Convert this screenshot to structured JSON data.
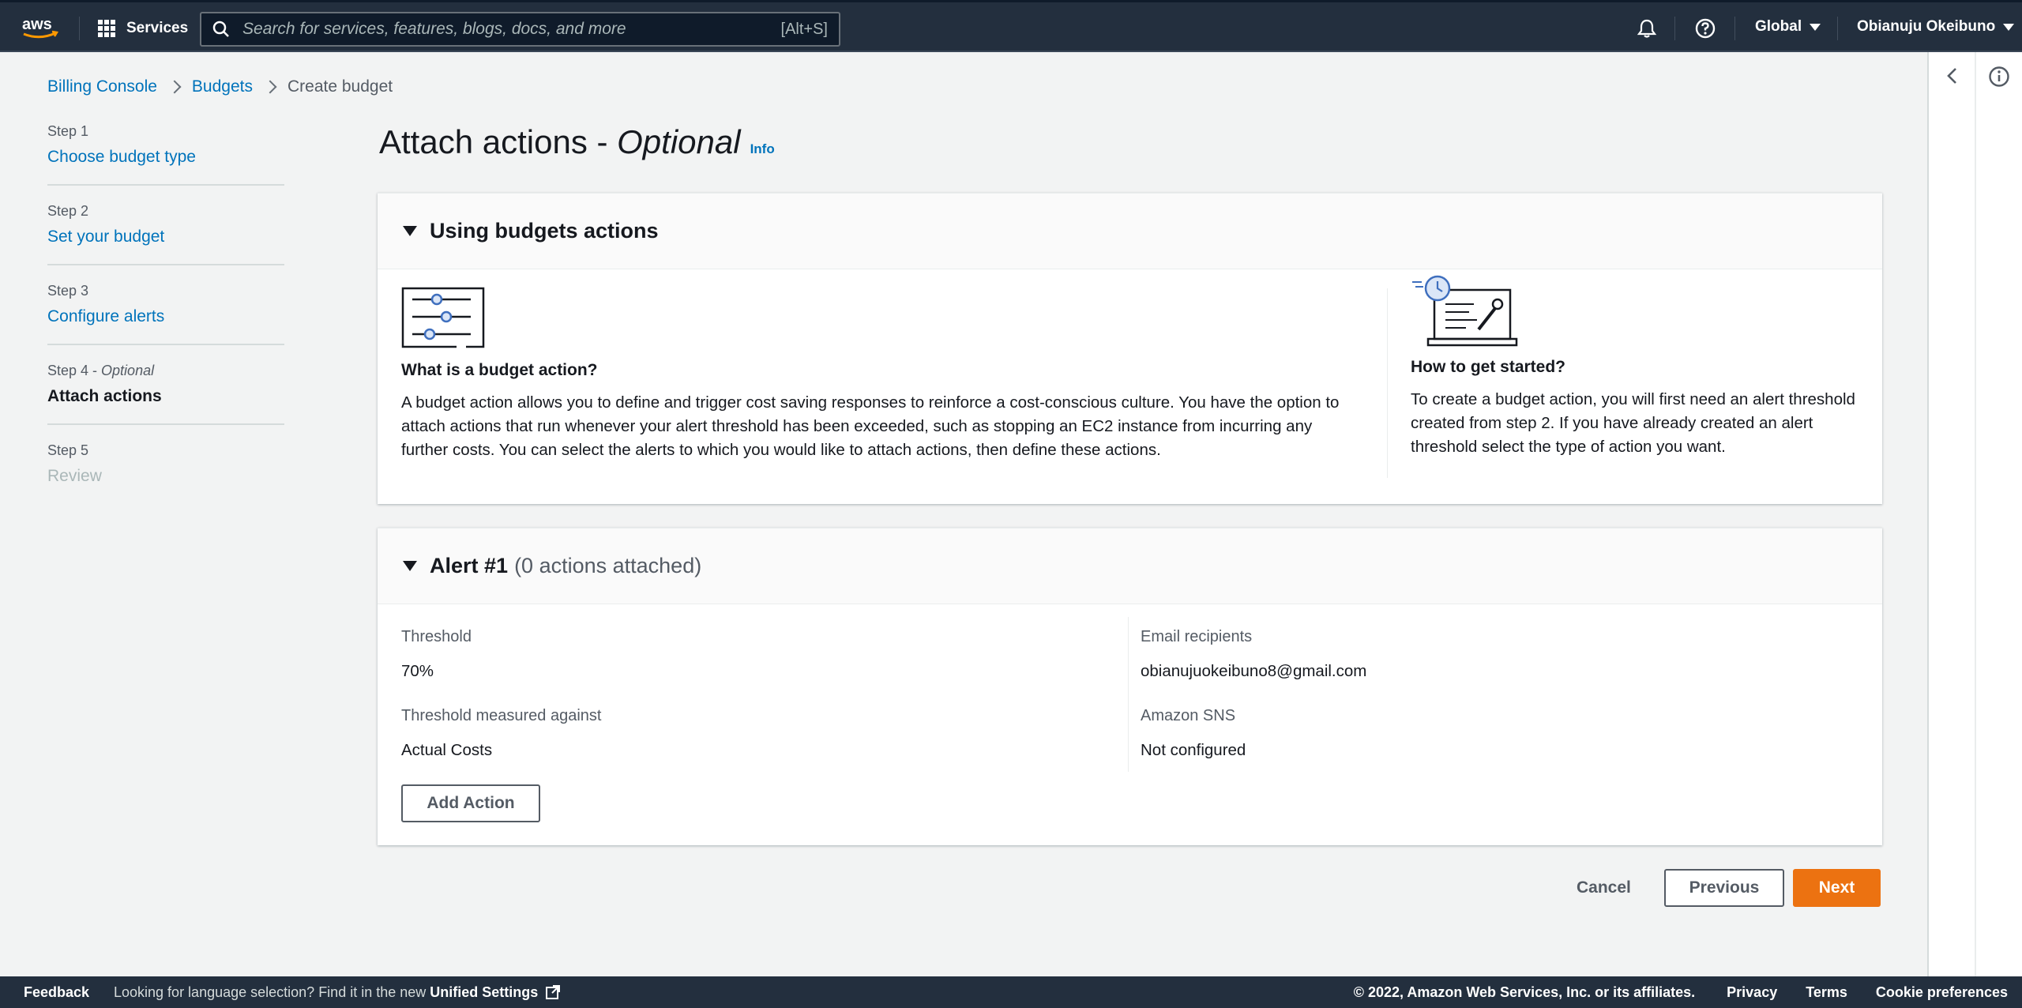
{
  "nav": {
    "services_label": "Services",
    "search_placeholder": "Search for services, features, blogs, docs, and more",
    "search_shortcut": "[Alt+S]",
    "region_label": "Global",
    "user_label": "Obianuju Okeibuno"
  },
  "breadcrumb": {
    "items": [
      "Billing Console",
      "Budgets"
    ],
    "current": "Create budget"
  },
  "steps": [
    {
      "num": "Step 1",
      "label": "Choose budget type"
    },
    {
      "num": "Step 2",
      "label": "Set your budget"
    },
    {
      "num": "Step 3",
      "label": "Configure alerts"
    },
    {
      "num": "Step 4",
      "optional": "Optional",
      "label": "Attach actions"
    },
    {
      "num": "Step 5",
      "label": "Review"
    }
  ],
  "page": {
    "title": "Attach actions - ",
    "title_optional": "Optional",
    "info_label": "Info"
  },
  "using_actions": {
    "header": "Using budgets actions",
    "left": {
      "heading": "What is a budget action?",
      "body": "A budget action allows you to define and trigger cost saving responses to reinforce a cost-conscious culture. You have the option to attach actions that run whenever your alert threshold has been exceeded, such as stopping an EC2 instance from incurring any further costs. You can select the alerts to which you would like to attach actions, then define these actions."
    },
    "right": {
      "heading": "How to get started?",
      "body": "To create a budget action, you will first need an alert threshold created from step 2. If you have already created an alert threshold select the type of action you want."
    }
  },
  "alert": {
    "header": "Alert #1",
    "header_sub": "(0 actions attached)",
    "threshold_label": "Threshold",
    "threshold_value": "70%",
    "measured_label": "Threshold measured against",
    "measured_value": "Actual Costs",
    "email_label": "Email recipients",
    "email_value": "obianujuokeibuno8@gmail.com",
    "sns_label": "Amazon SNS",
    "sns_value": "Not configured",
    "add_action_label": "Add Action"
  },
  "actions": {
    "cancel": "Cancel",
    "previous": "Previous",
    "next": "Next"
  },
  "footer": {
    "feedback": "Feedback",
    "lang_text": "Looking for language selection? Find it in the new ",
    "lang_link": "Unified Settings",
    "copyright": "© 2022, Amazon Web Services, Inc. or its affiliates.",
    "privacy": "Privacy",
    "terms": "Terms",
    "cookies": "Cookie preferences"
  },
  "colors": {
    "nav_bg": "#232f3e",
    "link": "#0073bb",
    "primary_button": "#ec7211"
  }
}
